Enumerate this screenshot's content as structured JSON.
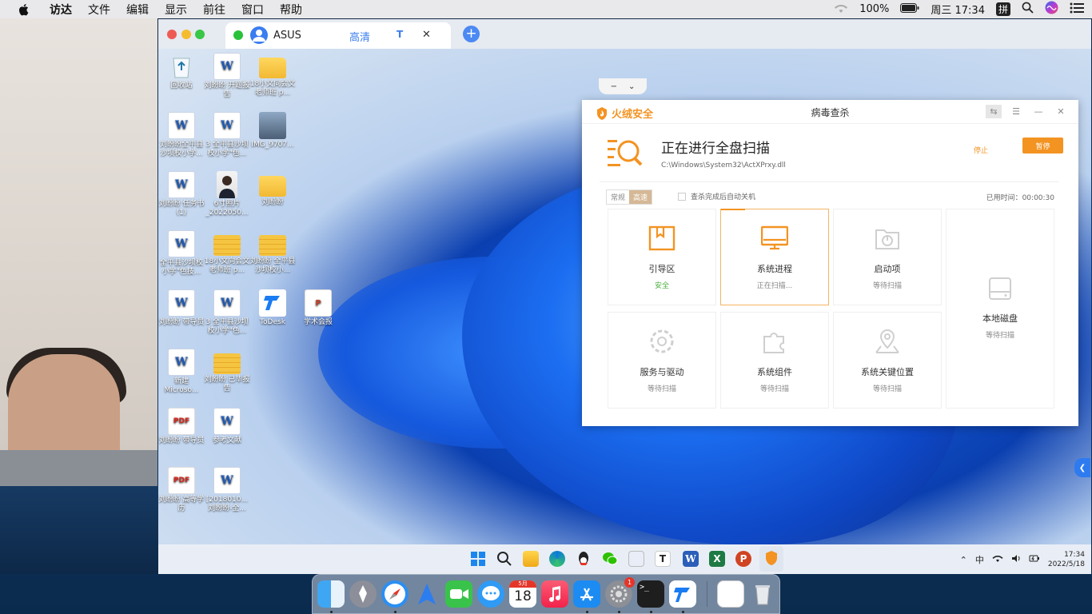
{
  "menubar": {
    "app": "访达",
    "items": [
      "文件",
      "编辑",
      "显示",
      "前往",
      "窗口",
      "帮助"
    ],
    "battery": "100%",
    "clock": "周三 17:34",
    "input_method": "拼"
  },
  "remote": {
    "tab_label": "ASUS",
    "quality": "高清",
    "quality_t": "T",
    "close": "✕",
    "add": "+",
    "knob_minus": "−",
    "knob_down": "⌄"
  },
  "desktop_icons": [
    {
      "label": "回收站",
      "kind": "recycle"
    },
    {
      "label": "刘盼盼 开题报告",
      "kind": "word"
    },
    {
      "label": "18小文向会文老师班 p...",
      "kind": "folder"
    },
    {
      "label": "刘盼盼全平县沙坝校小学...",
      "kind": "word"
    },
    {
      "label": "3 全平县沙坝校小学\"色...",
      "kind": "word"
    },
    {
      "label": "IMG_9707...",
      "kind": "photo"
    },
    {
      "label": "刘盼盼 任务书(1)",
      "kind": "word"
    },
    {
      "label": "6寸照片_2022050...",
      "kind": "idphoto"
    },
    {
      "label": "刘盼盼",
      "kind": "folder"
    },
    {
      "label": "全平县沙坝校小学\"色技...",
      "kind": "word"
    },
    {
      "label": "18小文向会文老师班 p...",
      "kind": "zip"
    },
    {
      "label": "刘盼盼 全平县沙坝校小...",
      "kind": "zip"
    },
    {
      "label": "刘盼盼 带导员",
      "kind": "word"
    },
    {
      "label": "3 全平县沙坝校小学\"色...",
      "kind": "word"
    },
    {
      "label": "ToDesk",
      "kind": "todesk"
    },
    {
      "label": "学术会报",
      "kind": "ppt"
    },
    {
      "label": "新建 Microso...",
      "kind": "word"
    },
    {
      "label": "刘盼盼 已毕报告",
      "kind": "zip"
    },
    {
      "label": "刘盼盼 带导员",
      "kind": "pdf"
    },
    {
      "label": "参考文献",
      "kind": "word"
    },
    {
      "label": "刘盼盼 高等学历",
      "kind": "pdf"
    },
    {
      "label": "[2018010... 刘盼盼-全...",
      "kind": "word"
    }
  ],
  "fire": {
    "brand": "火绒安全",
    "window_title": "病毒查杀",
    "ctrl_back": "⇆",
    "ctrl_menu": "☰",
    "ctrl_min": "—",
    "ctrl_close": "✕",
    "scan_title": "正在进行全盘扫描",
    "scan_path": "C:\\Windows\\System32\\ActXPrxy.dll",
    "stop": "停止",
    "pause": "暂停",
    "mode_normal": "常规",
    "mode_fast": "高速",
    "auto_shutdown": "查杀完成后自动关机",
    "elapsed": "已用时间：00:00:30",
    "cells": [
      {
        "name": "引导区",
        "status": "安全",
        "icon": "boot-icon"
      },
      {
        "name": "系统进程",
        "status": "正在扫描...",
        "icon": "monitor-icon"
      },
      {
        "name": "启动项",
        "status": "等待扫描",
        "icon": "power-icon"
      },
      {
        "name": "本地磁盘",
        "status": "等待扫描",
        "icon": "disk-icon"
      },
      {
        "name": "服务与驱动",
        "status": "等待扫描",
        "icon": "gear-icon"
      },
      {
        "name": "系统组件",
        "status": "等待扫描",
        "icon": "puzzle-icon"
      },
      {
        "name": "系统关键位置",
        "status": "等待扫描",
        "icon": "location-icon"
      }
    ]
  },
  "win_tray": {
    "ime": "中",
    "time": "17:34",
    "date": "2022/5/18"
  },
  "dock": {
    "calendar_month": "5月",
    "calendar_day": "18",
    "settings_badge": "1",
    "terminal_prompt": ">_"
  },
  "colors": {
    "accent_orange": "#f39322",
    "ok_green": "#4aae3b",
    "win_blue": "#1c6ef2"
  }
}
